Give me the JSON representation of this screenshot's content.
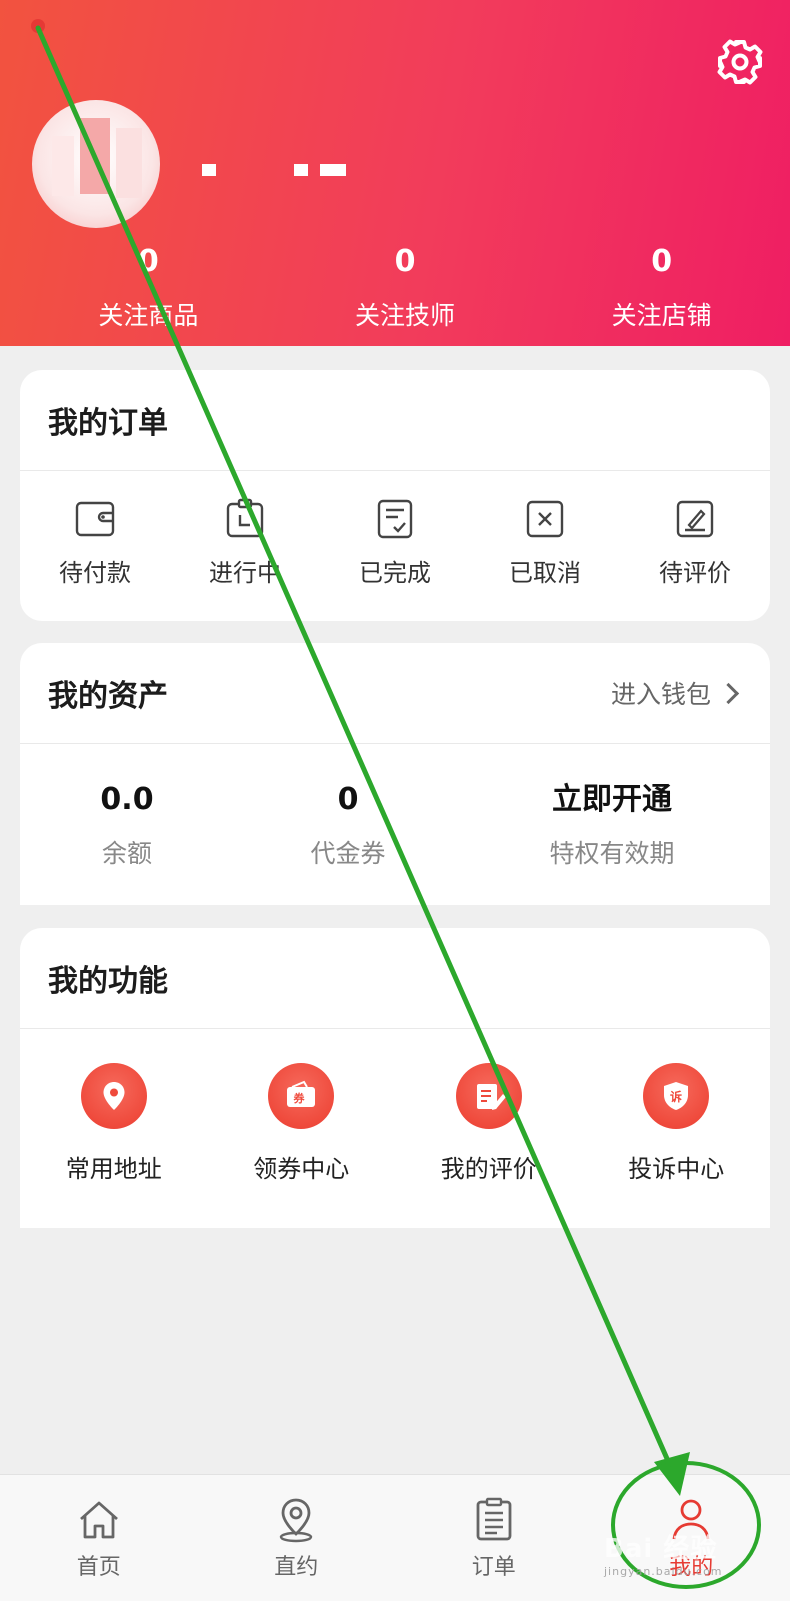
{
  "profile": {
    "stats": [
      {
        "value": "0",
        "label": "关注商品"
      },
      {
        "value": "0",
        "label": "关注技师"
      },
      {
        "value": "0",
        "label": "关注店铺"
      }
    ]
  },
  "orders": {
    "title": "我的订单",
    "items": [
      {
        "label": "待付款",
        "icon": "wallet-icon"
      },
      {
        "label": "进行中",
        "icon": "clipboard-icon"
      },
      {
        "label": "已完成",
        "icon": "document-check-icon"
      },
      {
        "label": "已取消",
        "icon": "cancel-box-icon"
      },
      {
        "label": "待评价",
        "icon": "pen-box-icon"
      }
    ]
  },
  "assets": {
    "title": "我的资产",
    "wallet_link": "进入钱包",
    "items": [
      {
        "value": "0.0",
        "label": "余额"
      },
      {
        "value": "0",
        "label": "代金券"
      },
      {
        "value": "立即开通",
        "label": "特权有效期"
      }
    ]
  },
  "functions": {
    "title": "我的功能",
    "items": [
      {
        "label": "常用地址",
        "icon": "location-pin-icon"
      },
      {
        "label": "领券中心",
        "icon": "coupon-icon",
        "glyph": "券"
      },
      {
        "label": "我的评价",
        "icon": "review-edit-icon"
      },
      {
        "label": "投诉中心",
        "icon": "complaint-shield-icon",
        "glyph": "诉"
      }
    ]
  },
  "tabbar": {
    "items": [
      {
        "label": "首页",
        "icon": "home-icon"
      },
      {
        "label": "直约",
        "icon": "location-icon"
      },
      {
        "label": "订单",
        "icon": "order-list-icon"
      },
      {
        "label": "我的",
        "icon": "user-icon",
        "active": true
      }
    ]
  },
  "colors": {
    "header_start": "#f2533f",
    "header_end": "#ef1e63",
    "accent": "#e63b33",
    "annotation_arrow": "#2ca82c"
  },
  "watermark": {
    "brand": "Bai 经验",
    "url": "jingyan.baidu.com"
  }
}
